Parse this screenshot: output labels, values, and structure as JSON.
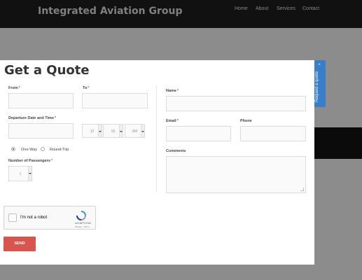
{
  "header": {
    "brand": "Integrated Aviation Group",
    "nav": [
      "Home",
      "About",
      "Services",
      "Contact"
    ]
  },
  "modal": {
    "title": "Get a Quote",
    "from_label": "From",
    "to_label": "To",
    "departure_label": "Departure Date and Time",
    "hour": "12",
    "minute": "00",
    "ampm": "AM",
    "trip_one_way": "One-Way",
    "trip_round": "Round-Trip",
    "selected_trip": "One-Way",
    "passengers_label": "Number of Passengers",
    "passengers_value": "1",
    "name_label": "Name",
    "email_label": "Email",
    "phone_label": "Phone",
    "comments_label": "Comments",
    "required_mark": "*"
  },
  "captcha": {
    "label": "I'm not a robot",
    "brand": "reCAPTCHA",
    "links": "Privacy - Terms"
  },
  "send_label": "SEND",
  "tab": {
    "label": "Request a quote"
  },
  "colors": {
    "accent_red": "#d9534f",
    "tab_blue": "#3a7dc9"
  }
}
